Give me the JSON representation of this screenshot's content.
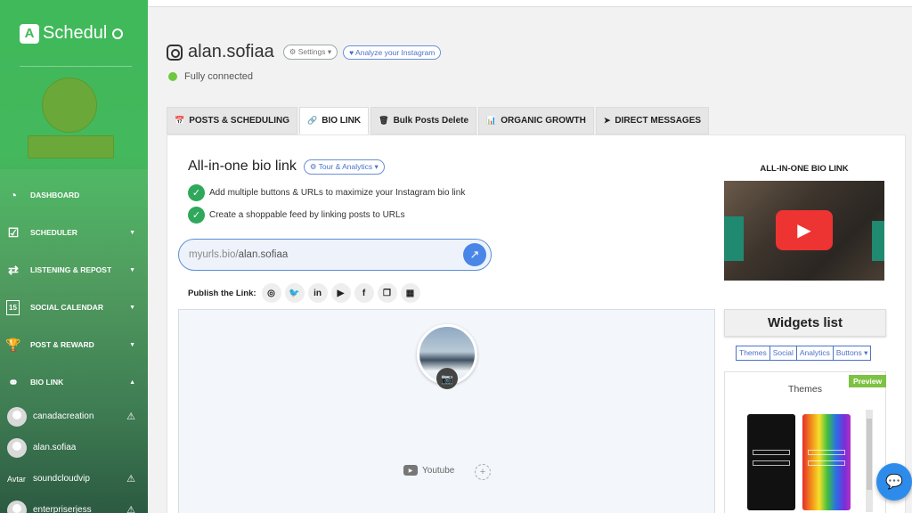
{
  "app": {
    "name": "Schedul",
    "logo_letter": "A"
  },
  "sidebar": {
    "nav": [
      {
        "label": "DASHBOARD",
        "icon": "dashboard-icon",
        "glyph": "◔",
        "caret": ""
      },
      {
        "label": "SCHEDULER",
        "icon": "calendar-check-icon",
        "glyph": "☑",
        "caret": "▼"
      },
      {
        "label": "LISTENING & REPOST",
        "icon": "repost-icon",
        "glyph": "⇄",
        "caret": "▼"
      },
      {
        "label": "SOCIAL CALENDAR",
        "icon": "calendar-icon",
        "glyph": "15",
        "caret": "▼"
      },
      {
        "label": "POST & REWARD",
        "icon": "trophy-icon",
        "glyph": "🏆",
        "caret": "▼"
      },
      {
        "label": "BIO LINK",
        "icon": "link-icon",
        "glyph": "⚭",
        "caret": "▲"
      }
    ],
    "accounts": [
      {
        "name": "canadacreation",
        "warning": "⚠"
      },
      {
        "name": "alan.sofiaa",
        "warning": ""
      },
      {
        "name": "soundcloudvip",
        "warning": "⚠",
        "broken_img_alt": "Avtar"
      },
      {
        "name": "enterpriserjess",
        "warning": "⚠"
      }
    ]
  },
  "header": {
    "account_name": "alan.sofiaa",
    "settings_label": "Settings",
    "analyze_label": "Analyze your Instagram",
    "status": "Fully connected",
    "status_color": "#6ec83e"
  },
  "tabs": [
    {
      "label": "POSTS & SCHEDULING",
      "icon": "calendar-check-icon",
      "glyph": "📅",
      "active": false
    },
    {
      "label": "BIO LINK",
      "icon": "link-icon",
      "glyph": "🔗",
      "active": true
    },
    {
      "label": "Bulk Posts Delete",
      "icon": "trash-icon",
      "glyph": "🗑",
      "active": false
    },
    {
      "label": "ORGANIC GROWTH",
      "icon": "bar-chart-icon",
      "glyph": "📊",
      "active": false
    },
    {
      "label": "DIRECT MESSAGES",
      "icon": "send-icon",
      "glyph": "➤",
      "active": false
    }
  ],
  "bio": {
    "title": "All-in-one bio link",
    "tour_label": "Tour & Analytics",
    "features": [
      "Add multiple buttons & URLs to maximize your Instagram bio link",
      "Create a shoppable feed by linking posts to URLs"
    ],
    "url_prefix": "myurls.bio/",
    "url_user": "alan.sofiaa",
    "publish_label": "Publish the Link:",
    "publish_icons": [
      {
        "name": "instagram-icon",
        "glyph": "◎"
      },
      {
        "name": "twitter-icon",
        "glyph": "🐦"
      },
      {
        "name": "linkedin-icon",
        "glyph": "in"
      },
      {
        "name": "youtube-icon",
        "glyph": "▶"
      },
      {
        "name": "facebook-icon",
        "glyph": "f"
      },
      {
        "name": "copy-icon",
        "glyph": "❐"
      },
      {
        "name": "qr-code-icon",
        "glyph": "▦"
      }
    ],
    "preview_widget": "Youtube"
  },
  "right_panel": {
    "video_title": "ALL-IN-ONE BIO LINK",
    "widgets_title": "Widgets list",
    "widget_tabs": [
      "Themes",
      "Social",
      "Analytics",
      "Buttons"
    ],
    "themes_label": "Themes",
    "preview_badge": "Preview"
  }
}
